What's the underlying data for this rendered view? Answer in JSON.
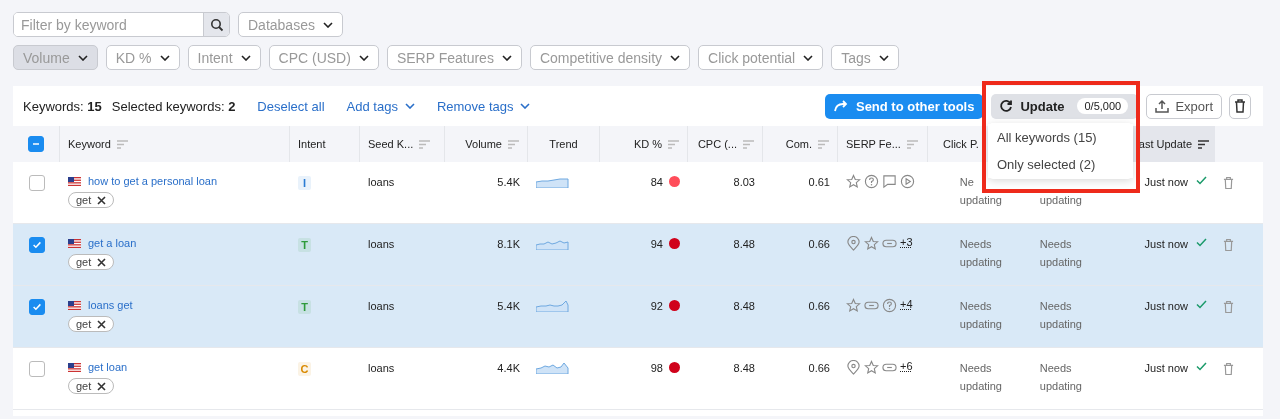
{
  "search": {
    "placeholder": "Filter by keyword"
  },
  "database_dropdown": {
    "label": "Databases"
  },
  "filters": [
    {
      "label": "Volume",
      "selected": true
    },
    {
      "label": "KD %",
      "selected": false
    },
    {
      "label": "Intent",
      "selected": false
    },
    {
      "label": "CPC (USD)",
      "selected": false
    },
    {
      "label": "SERP Features",
      "selected": false
    },
    {
      "label": "Competitive density",
      "selected": false
    },
    {
      "label": "Click potential",
      "selected": false
    },
    {
      "label": "Tags",
      "selected": false
    }
  ],
  "toolbar": {
    "keywords_label": "Keywords:",
    "keywords_count": "15",
    "selected_label": "Selected keywords:",
    "selected_count": "2",
    "deselect": "Deselect all",
    "add_tags": "Add tags",
    "remove_tags": "Remove tags",
    "send": "Send to other tools",
    "update": "Update",
    "update_quota": "0/5,000",
    "export": "Export"
  },
  "update_menu": {
    "expanded": true,
    "items": [
      "All keywords (15)",
      "Only selected (2)"
    ]
  },
  "table": {
    "select_all_indeterminate": true,
    "columns": [
      {
        "label": "Keyword",
        "sort": true
      },
      {
        "label": "Intent",
        "sort": false
      },
      {
        "label": "Seed K...",
        "sort": true
      },
      {
        "label": "Volume",
        "sort": true
      },
      {
        "label": "Trend",
        "sort": false
      },
      {
        "label": "KD %",
        "sort": true
      },
      {
        "label": "CPC (...",
        "sort": true
      },
      {
        "label": "Com.",
        "sort": true
      },
      {
        "label": "SERP Fe...",
        "sort": true
      },
      {
        "label": "Click P.",
        "sort": false
      },
      {
        "label": "ast Update",
        "sort": true
      }
    ],
    "rows": [
      {
        "selected": false,
        "keyword": "how to get a personal loan",
        "tag": "get",
        "intent": {
          "letter": "I",
          "color": "#2a7bd3"
        },
        "seed": "loans",
        "volume": "5.4K",
        "kd": {
          "value": "84",
          "color": "#ff4d5a"
        },
        "cpc": "8.03",
        "com": "0.61",
        "serp": [
          {
            "kind": "star"
          },
          {
            "kind": "question"
          },
          {
            "kind": "comment"
          },
          {
            "kind": "play"
          }
        ],
        "click": [
          "Ne",
          "updating"
        ],
        "column_11": [
          "updating"
        ],
        "last_update": "Just now"
      },
      {
        "selected": true,
        "keyword": "get a loan",
        "tag": "get",
        "intent": {
          "letter": "T",
          "color": "#2e9a3a"
        },
        "seed": "loans",
        "volume": "8.1K",
        "kd": {
          "value": "94",
          "color": "#d0021b"
        },
        "cpc": "8.48",
        "com": "0.66",
        "serp": [
          {
            "kind": "pin"
          },
          {
            "kind": "star"
          },
          {
            "kind": "link"
          }
        ],
        "serp_more": "+3",
        "click": [
          "Needs",
          "updating"
        ],
        "column_11": [
          "Needs",
          "updating"
        ],
        "last_update": "Just now"
      },
      {
        "selected": true,
        "keyword": "loans get",
        "tag": "get",
        "intent": {
          "letter": "T",
          "color": "#2e9a3a"
        },
        "seed": "loans",
        "volume": "5.4K",
        "kd": {
          "value": "92",
          "color": "#d0021b"
        },
        "cpc": "8.48",
        "com": "0.66",
        "serp": [
          {
            "kind": "star"
          },
          {
            "kind": "link"
          },
          {
            "kind": "question"
          }
        ],
        "serp_more": "+4",
        "click": [
          "Needs",
          "updating"
        ],
        "column_11": [
          "Needs",
          "updating"
        ],
        "last_update": "Just now"
      },
      {
        "selected": false,
        "keyword": "get loan",
        "tag": "get",
        "intent": {
          "letter": "C",
          "color": "#d98a00"
        },
        "seed": "loans",
        "volume": "4.4K",
        "kd": {
          "value": "98",
          "color": "#d0021b"
        },
        "cpc": "8.48",
        "com": "0.66",
        "serp": [
          {
            "kind": "pin"
          },
          {
            "kind": "star"
          },
          {
            "kind": "link"
          }
        ],
        "serp_more": "+6",
        "click": [
          "Needs",
          "updating"
        ],
        "column_11": [
          "Needs",
          "updating"
        ],
        "last_update": "Just now"
      }
    ]
  }
}
